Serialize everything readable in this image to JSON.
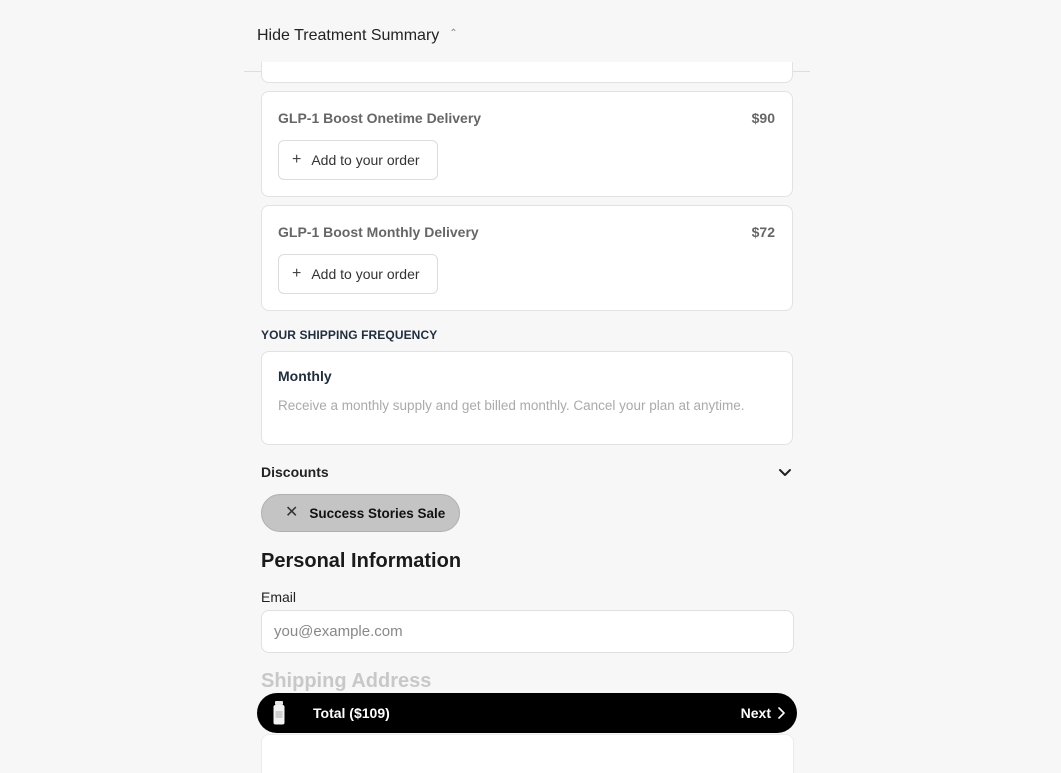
{
  "summary": {
    "toggle_label": "Hide Treatment Summary",
    "caret_icon": "chevron-up-icon"
  },
  "addons": [
    {
      "name": "GLP-1 Boost Onetime Delivery",
      "price": "$90",
      "button_label": "Add to your order",
      "button_icon": "plus-icon"
    },
    {
      "name": "GLP-1 Boost Monthly Delivery",
      "price": "$72",
      "button_label": "Add to your order",
      "button_icon": "plus-icon"
    }
  ],
  "shipping_frequency": {
    "heading": "YOUR SHIPPING FREQUENCY",
    "plan": "Monthly",
    "description": "Receive a monthly supply and get billed monthly. Cancel your plan at anytime."
  },
  "discounts": {
    "label": "Discounts",
    "toggle_icon": "chevron-down-icon",
    "applied": [
      {
        "label": "Success Stories Sale",
        "remove_icon": "close-icon"
      }
    ]
  },
  "personal_info": {
    "title": "Personal Information",
    "email_label": "Email",
    "email_value": "",
    "email_placeholder": "you@example.com"
  },
  "shipping_address": {
    "title": "Shipping Address"
  },
  "footer": {
    "product_icon": "bottle-icon",
    "total_label": "Total ($109)",
    "next_label": "Next",
    "next_icon": "chevron-right-icon"
  },
  "colors": {
    "background": "#f7f7f7",
    "card": "#ffffff",
    "footer_bar": "#000000",
    "discount_pill": "#c4c4c4",
    "frequency_text": "#1f2d3d"
  }
}
